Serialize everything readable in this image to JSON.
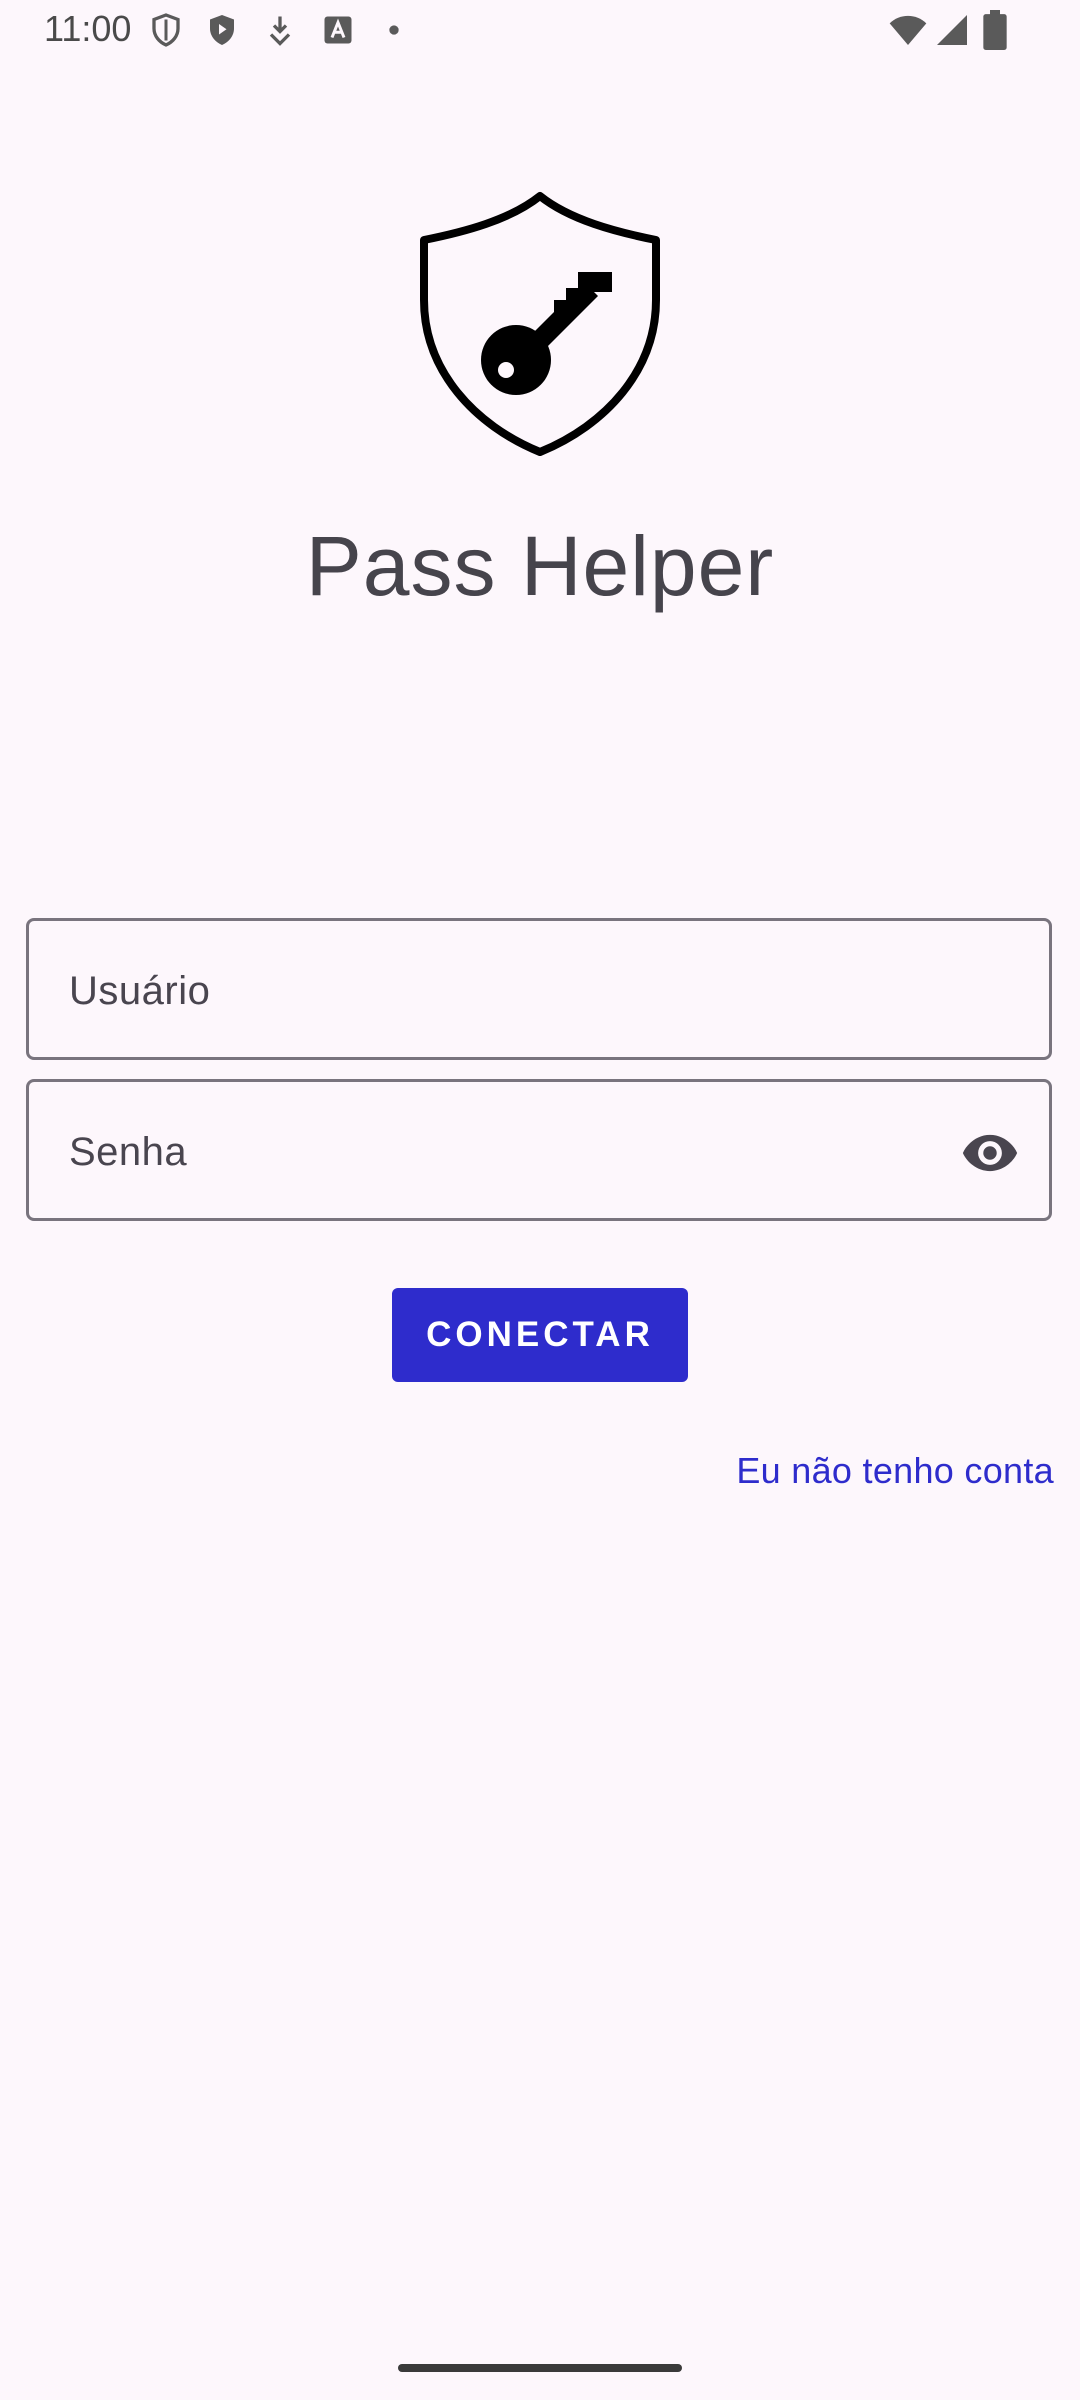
{
  "status_bar": {
    "time": "11:00",
    "left_icons": [
      "shield-outline-icon",
      "play-shield-icon",
      "download-icon",
      "font-a-icon",
      "dot-icon"
    ],
    "right_icons": [
      "wifi-icon",
      "cellular-signal-icon",
      "battery-icon"
    ]
  },
  "app": {
    "title": "Pass Helper",
    "logo": "shield-key-logo"
  },
  "form": {
    "username_label": "Usuário",
    "password_label": "Senha",
    "password_toggle_icon": "eye-icon",
    "connect_label": "CONECTAR",
    "no_account_label": "Eu não tenho conta"
  },
  "colors": {
    "background": "#fdf7fc",
    "primary": "#2e2ccc",
    "title": "#46444c",
    "outline": "#79747e"
  }
}
